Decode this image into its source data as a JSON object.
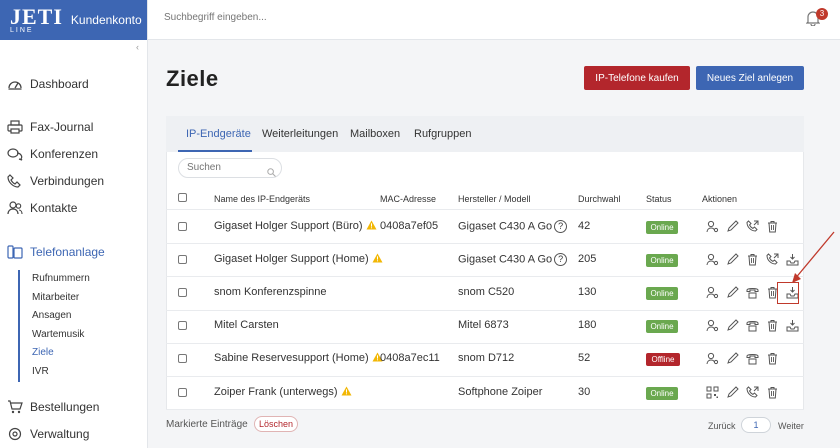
{
  "brand": {
    "logo_top": "JETI",
    "logo_bottom": "LINE",
    "label": "Kundenkonto"
  },
  "topbar": {
    "search_placeholder": "Suchbegriff eingeben...",
    "notification_count": "3"
  },
  "sidebar": {
    "items": [
      {
        "label": "Dashboard",
        "icon": "speedometer-icon"
      },
      {
        "label": "Fax-Journal",
        "icon": "printer-icon"
      },
      {
        "label": "Konferenzen",
        "icon": "chat-bubbles-icon"
      },
      {
        "label": "Verbindungen",
        "icon": "phone-icon"
      },
      {
        "label": "Kontakte",
        "icon": "people-icon"
      },
      {
        "label": "Telefonanlage",
        "icon": "pbx-icon"
      },
      {
        "label": "Bestellungen",
        "icon": "cart-icon"
      },
      {
        "label": "Verwaltung",
        "icon": "gear-icon"
      }
    ],
    "subitems": [
      "Rufnummern",
      "Mitarbeiter",
      "Ansagen",
      "Wartemusik",
      "Ziele",
      "IVR"
    ]
  },
  "page": {
    "title": "Ziele",
    "buy_button": "IP-Telefone kaufen",
    "new_button": "Neues Ziel anlegen"
  },
  "tabs": [
    "IP-Endgeräte",
    "Weiterleitungen",
    "Mailboxen",
    "Rufgruppen"
  ],
  "table": {
    "search_placeholder": "Suchen",
    "headers": [
      "Name des IP-Endgeräts",
      "MAC-Adresse",
      "Hersteller / Modell",
      "Durchwahl",
      "Status",
      "Aktionen"
    ],
    "rows": [
      {
        "name": "Gigaset Holger Support (Büro)",
        "warn": true,
        "mac": "0408a7ef05",
        "model": "Gigaset C430 A Go",
        "help": true,
        "ext": "42",
        "status": "Online",
        "actions": [
          "user-settings-icon",
          "pencil-icon",
          "phone-forward-icon",
          "trash-icon"
        ]
      },
      {
        "name": "Gigaset Holger Support (Home)",
        "warn": true,
        "mac": "",
        "model": "Gigaset C430 A Go",
        "help": true,
        "ext": "205",
        "status": "Online",
        "actions": [
          "user-settings-icon",
          "pencil-icon",
          "trash-icon",
          "phone-forward-icon",
          "inbox-download-icon"
        ]
      },
      {
        "name": "snom Konferenzspinne",
        "warn": false,
        "mac": "",
        "model": "snom C520",
        "help": false,
        "ext": "130",
        "status": "Online",
        "actions": [
          "user-settings-icon",
          "pencil-icon",
          "desk-phone-icon",
          "trash-icon",
          "inbox-download-icon"
        ]
      },
      {
        "name": "Mitel Carsten",
        "warn": false,
        "mac": "",
        "model": "Mitel 6873",
        "help": false,
        "ext": "180",
        "status": "Online",
        "actions": [
          "user-settings-icon",
          "pencil-icon",
          "desk-phone-icon",
          "trash-icon",
          "inbox-download-icon"
        ]
      },
      {
        "name": "Sabine Reservesupport (Home)",
        "warn": true,
        "mac": "0408a7ec11",
        "model": "snom D712",
        "help": false,
        "ext": "52",
        "status": "Offline",
        "actions": [
          "user-settings-icon",
          "pencil-icon",
          "desk-phone-icon",
          "trash-icon"
        ]
      },
      {
        "name": "Zoiper Frank (unterwegs)",
        "warn": true,
        "mac": "",
        "model": "Softphone Zoiper",
        "help": false,
        "ext": "30",
        "status": "Online",
        "actions": [
          "qr-code-icon",
          "pencil-icon",
          "phone-forward-icon",
          "trash-icon"
        ]
      }
    ]
  },
  "footer": {
    "selected_label": "Markierte Einträge",
    "delete_label": "Löschen",
    "prev_label": "Zurück",
    "page": "1",
    "next_label": "Weiter"
  },
  "colors": {
    "primary": "#3d66b3",
    "danger": "#b3262c",
    "online": "#6aa84f"
  }
}
